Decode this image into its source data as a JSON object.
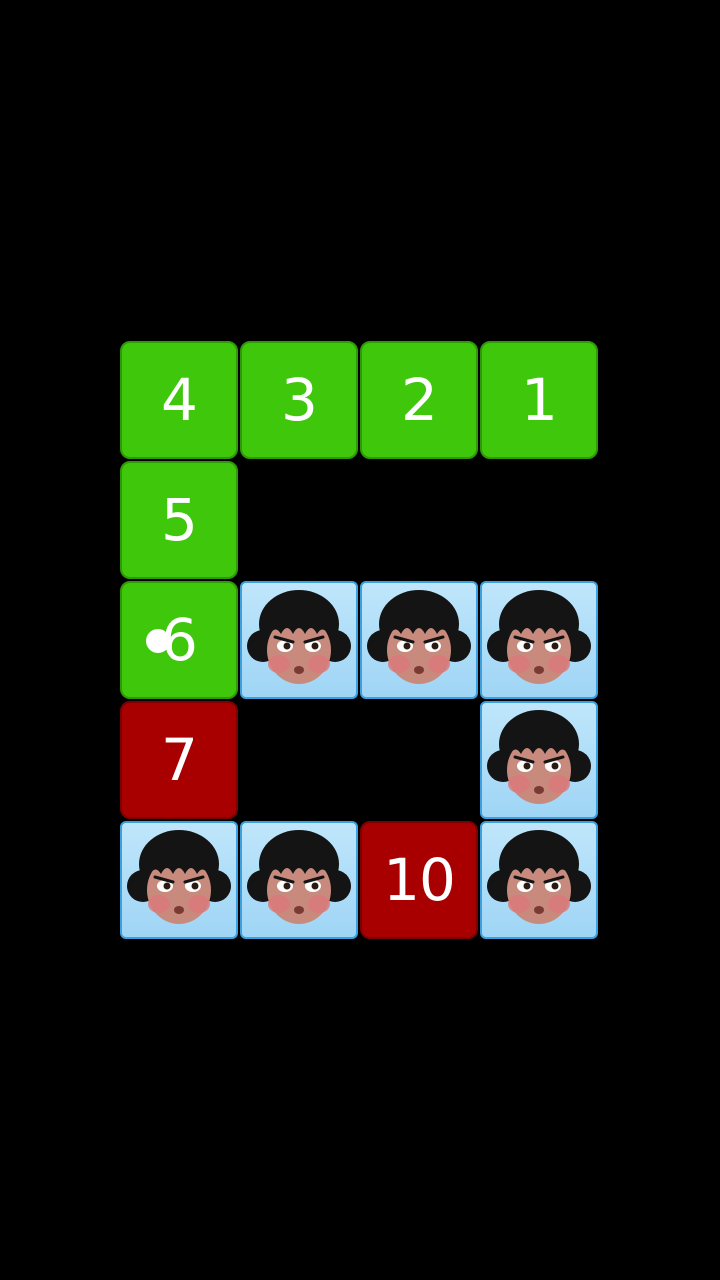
{
  "board": {
    "rows": 5,
    "cols": 4,
    "colors": {
      "path_tile": "#3fc70c",
      "blocked_tile": "#a80000",
      "face_tile": "#bfe6fb"
    },
    "tiles": [
      {
        "row": 0,
        "col": 0,
        "kind": "number",
        "color": "green",
        "label": "4"
      },
      {
        "row": 0,
        "col": 1,
        "kind": "number",
        "color": "green",
        "label": "3"
      },
      {
        "row": 0,
        "col": 2,
        "kind": "number",
        "color": "green",
        "label": "2"
      },
      {
        "row": 0,
        "col": 3,
        "kind": "number",
        "color": "green",
        "label": "1"
      },
      {
        "row": 1,
        "col": 0,
        "kind": "number",
        "color": "green",
        "label": "5"
      },
      {
        "row": 2,
        "col": 0,
        "kind": "number",
        "color": "green",
        "label": "6",
        "cursor": true
      },
      {
        "row": 2,
        "col": 1,
        "kind": "face",
        "icon": "girl-face-icon"
      },
      {
        "row": 2,
        "col": 2,
        "kind": "face",
        "icon": "girl-face-icon"
      },
      {
        "row": 2,
        "col": 3,
        "kind": "face",
        "icon": "girl-face-icon"
      },
      {
        "row": 3,
        "col": 0,
        "kind": "number",
        "color": "red",
        "label": "7"
      },
      {
        "row": 3,
        "col": 3,
        "kind": "face",
        "icon": "girl-face-icon"
      },
      {
        "row": 4,
        "col": 0,
        "kind": "face",
        "icon": "girl-face-icon"
      },
      {
        "row": 4,
        "col": 1,
        "kind": "face",
        "icon": "girl-face-icon"
      },
      {
        "row": 4,
        "col": 2,
        "kind": "number",
        "color": "red",
        "label": "10"
      },
      {
        "row": 4,
        "col": 3,
        "kind": "face",
        "icon": "girl-face-icon"
      }
    ]
  }
}
